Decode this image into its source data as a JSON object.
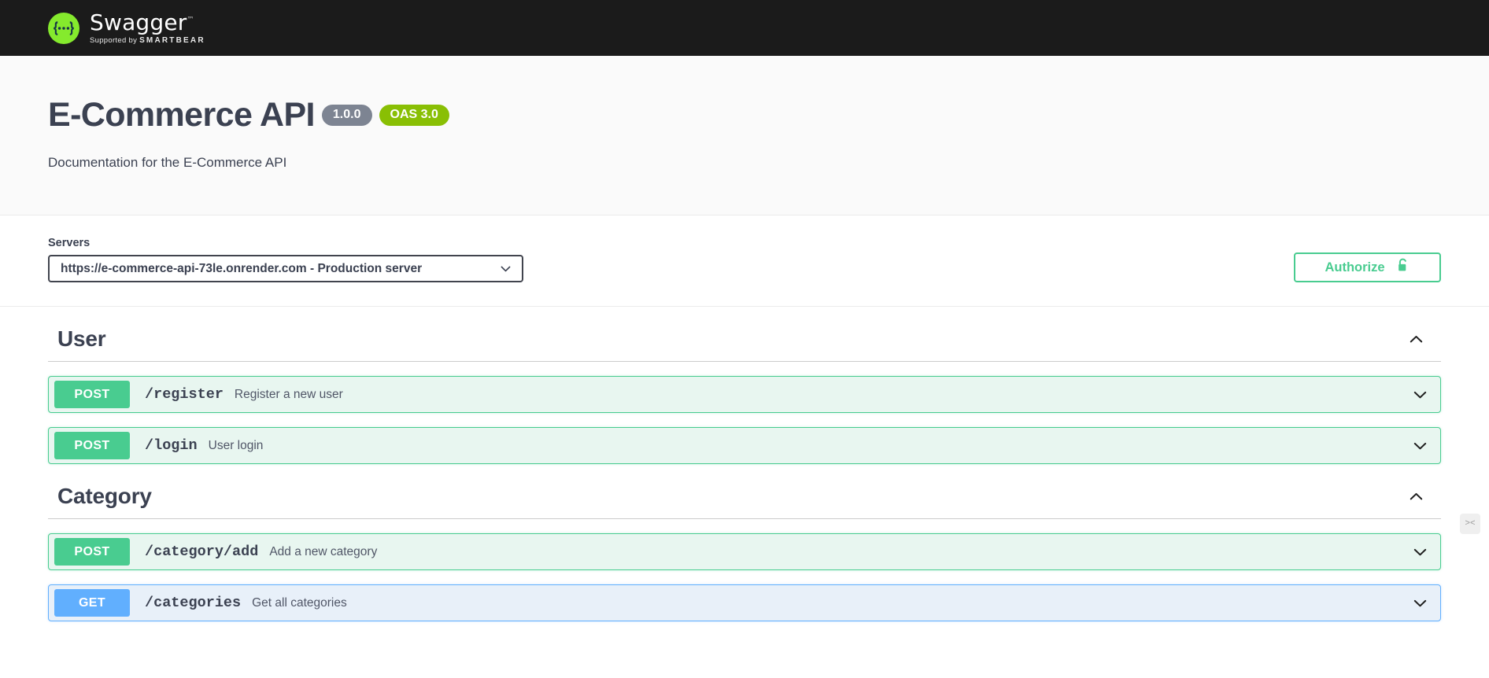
{
  "topbar": {
    "logo_icon": "swagger-braces-logo",
    "brand": "Swagger",
    "trademark": "™",
    "supported_by_prefix": "Supported by ",
    "supported_by_brand": "SMARTBEAR"
  },
  "info": {
    "title": "E-Commerce API",
    "version_badge": "1.0.0",
    "oas_badge": "OAS 3.0",
    "description": "Documentation for the E-Commerce API"
  },
  "scheme": {
    "servers_label": "Servers",
    "selected_server": "https://e-commerce-api-73le.onrender.com - Production server",
    "dropdown_icon": "chevron-down-icon",
    "authorize_label": "Authorize",
    "authorize_icon": "unlock-icon"
  },
  "sections": [
    {
      "name": "User",
      "toggle_icon": "chevron-up-icon",
      "operations": [
        {
          "method": "POST",
          "path": "/register",
          "summary": "Register a new user",
          "expand_icon": "chevron-down-icon",
          "style": "post"
        },
        {
          "method": "POST",
          "path": "/login",
          "summary": "User login",
          "expand_icon": "chevron-down-icon",
          "style": "post"
        }
      ]
    },
    {
      "name": "Category",
      "toggle_icon": "chevron-up-icon",
      "operations": [
        {
          "method": "POST",
          "path": "/category/add",
          "summary": "Add a new category",
          "expand_icon": "chevron-down-icon",
          "style": "post"
        },
        {
          "method": "GET",
          "path": "/categories",
          "summary": "Get all categories",
          "expand_icon": "chevron-down-icon",
          "style": "get"
        }
      ]
    }
  ],
  "mini_widget": {
    "icon": "collapse-handle-icon",
    "label": "><"
  },
  "colors": {
    "post": "#49cc90",
    "get": "#61affe",
    "oas_green": "#89bf04",
    "version_gray": "#7d8492",
    "topbar": "#1b1b1b",
    "text": "#3b4151"
  }
}
